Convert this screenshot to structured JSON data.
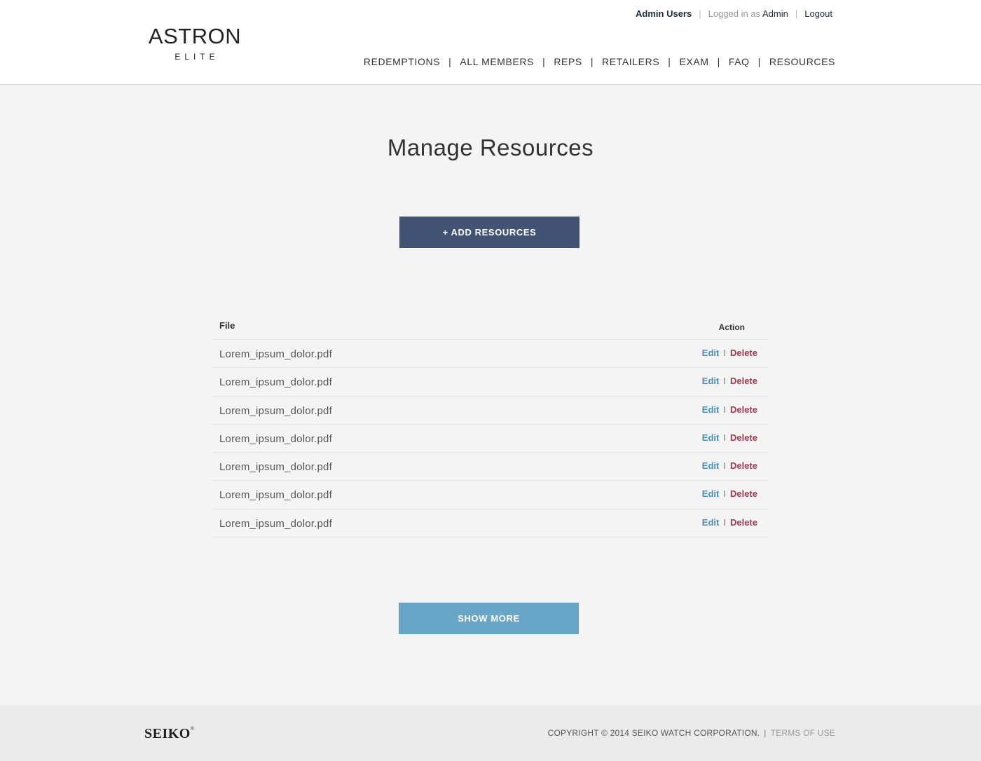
{
  "header": {
    "logo_main": "ASTRON",
    "logo_sub": "ELITE",
    "topbar": {
      "admin_users": "Admin Users",
      "sep": "|",
      "logged_in_as": "Logged in as",
      "admin_name": "Admin",
      "logout": "Logout"
    },
    "nav": [
      "REDEMPTIONS",
      "ALL MEMBERS",
      "REPS",
      "RETAILERS",
      "EXAM",
      "FAQ",
      "RESOURCES"
    ],
    "nav_sep": "|"
  },
  "main": {
    "title": "Manage Resources",
    "add_button": "+ ADD RESOURCES",
    "table": {
      "headers": {
        "file": "File",
        "action": "Action"
      },
      "rows": [
        {
          "file": "Lorem_ipsum_dolor.pdf",
          "edit": "Edit",
          "sep": "I",
          "delete": "Delete"
        },
        {
          "file": "Lorem_ipsum_dolor.pdf",
          "edit": "Edit",
          "sep": "I",
          "delete": "Delete"
        },
        {
          "file": "Lorem_ipsum_dolor.pdf",
          "edit": "Edit",
          "sep": "I",
          "delete": "Delete"
        },
        {
          "file": "Lorem_ipsum_dolor.pdf",
          "edit": "Edit",
          "sep": "I",
          "delete": "Delete"
        },
        {
          "file": "Lorem_ipsum_dolor.pdf",
          "edit": "Edit",
          "sep": "I",
          "delete": "Delete"
        },
        {
          "file": "Lorem_ipsum_dolor.pdf",
          "edit": "Edit",
          "sep": "I",
          "delete": "Delete"
        },
        {
          "file": "Lorem_ipsum_dolor.pdf",
          "edit": "Edit",
          "sep": "I",
          "delete": "Delete"
        }
      ]
    },
    "show_more": "SHOW MORE"
  },
  "footer": {
    "brand": "SEIKO",
    "brand_mark": "®",
    "copyright": "COPYRIGHT © 2014 SEIKO WATCH CORPORATION.",
    "sep": "|",
    "terms": "TERMS OF USE"
  },
  "colors": {
    "add_button": "#425373",
    "show_more_button": "#67a6c6",
    "edit_link": "#4a8fb8",
    "delete_link": "#a03a52"
  }
}
